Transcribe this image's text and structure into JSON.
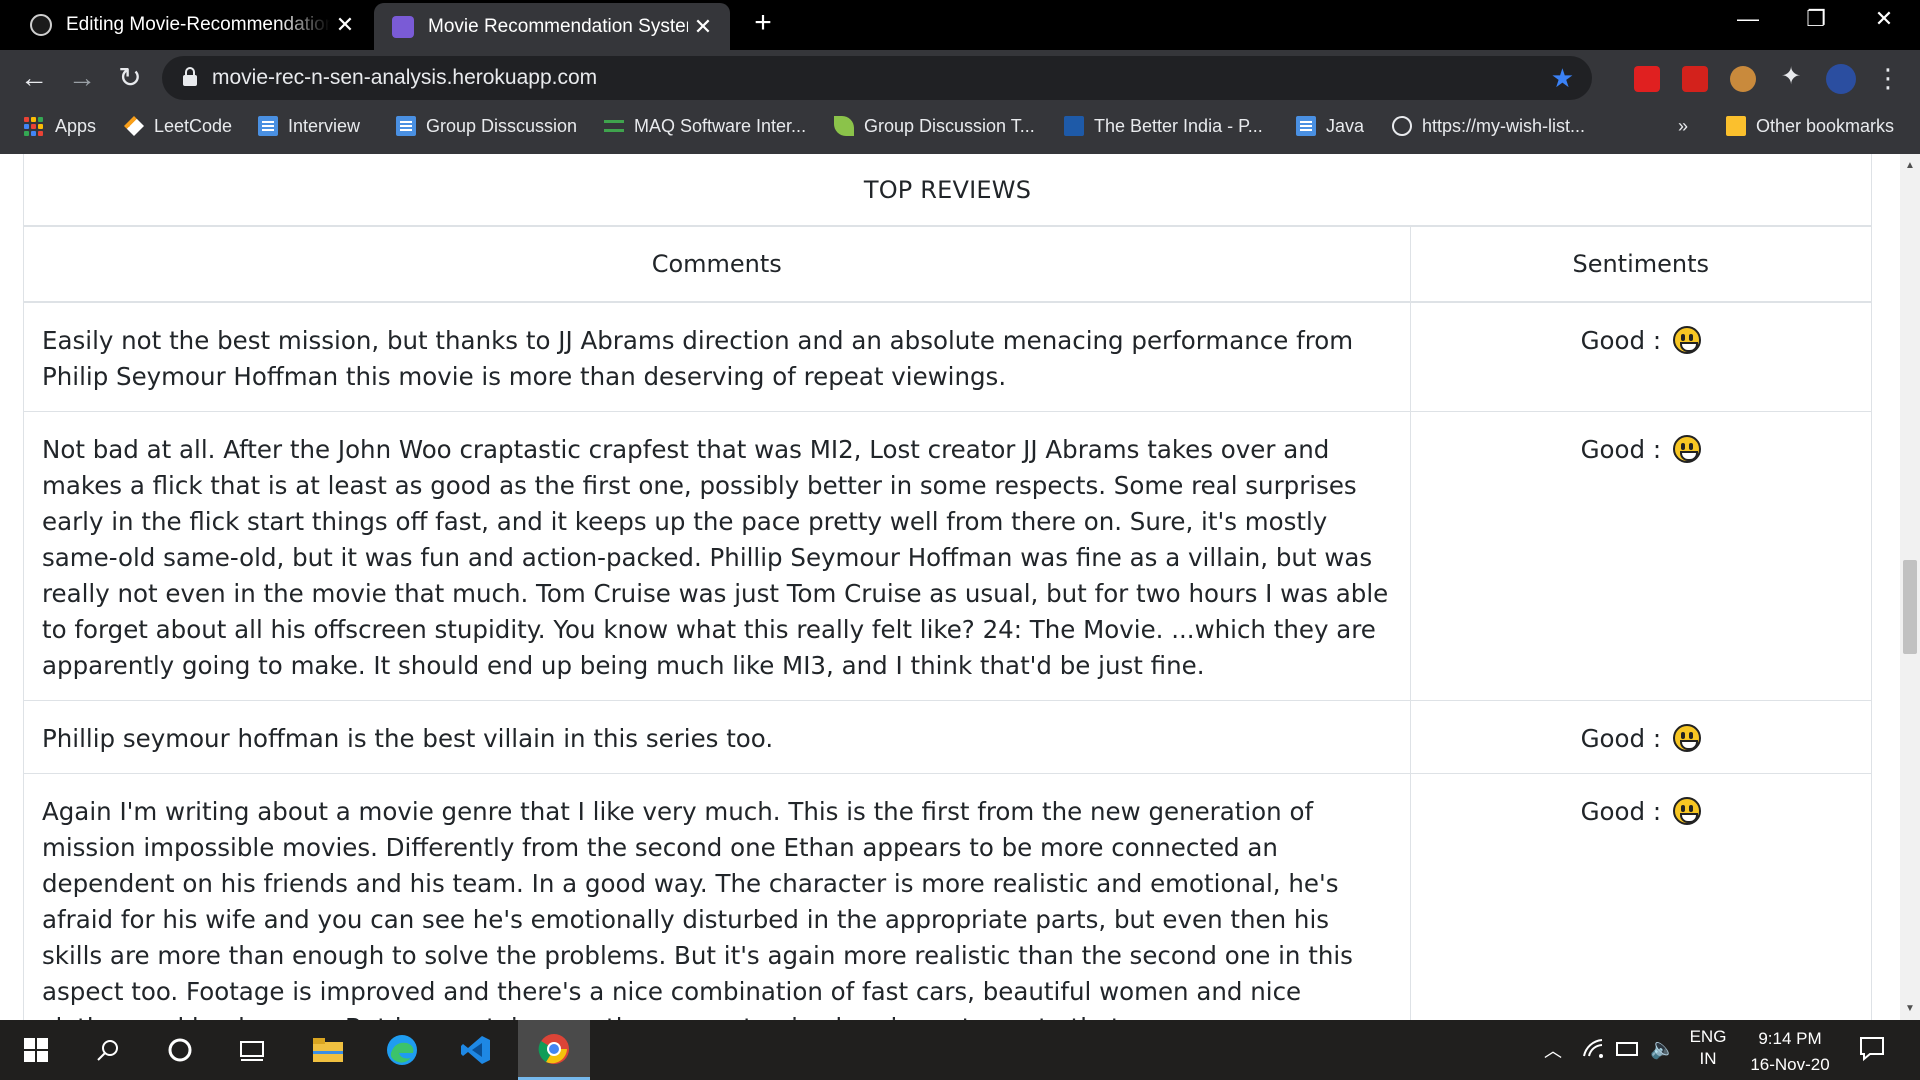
{
  "browser": {
    "tabs": [
      {
        "title": "Editing Movie-Recommendation",
        "close": "✕"
      },
      {
        "title": "Movie Recommendation System",
        "close": "✕"
      }
    ],
    "new_tab": "+",
    "window": {
      "minimize": "—",
      "restore": "❐",
      "close": "✕"
    },
    "nav": {
      "back": "←",
      "forward": "→",
      "reload": "↻"
    },
    "url": "movie-rec-n-sen-analysis.herokuapp.com",
    "bookmark_star": "★",
    "menu": "⋮",
    "extensions_icon": "✦",
    "bookmarks": [
      {
        "label": "Apps",
        "icon": "apps-grid-icon"
      },
      {
        "label": "LeetCode",
        "icon": "leetcode-icon"
      },
      {
        "label": "Interview",
        "icon": "docs-icon"
      },
      {
        "label": "Group Disscussion",
        "icon": "docs-icon"
      },
      {
        "label": "MAQ Software Inter...",
        "icon": "maq-icon"
      },
      {
        "label": "Group Discussion T...",
        "icon": "leaf-icon"
      },
      {
        "label": "The Better India - P...",
        "icon": "better-india-icon"
      },
      {
        "label": "Java",
        "icon": "docs-icon"
      },
      {
        "label": "https://my-wish-list...",
        "icon": "globe-icon"
      }
    ],
    "bookmarks_overflow": "»",
    "other_bookmarks": "Other bookmarks"
  },
  "page": {
    "section_title": "TOP REVIEWS",
    "columns": {
      "comments": "Comments",
      "sentiments": "Sentiments"
    },
    "reviews": [
      {
        "comment": "Easily not the best mission, but thanks to JJ Abrams direction and an absolute menacing performance from Philip Seymour Hoffman this movie is more than deserving of repeat viewings.",
        "sentiment": "Good :"
      },
      {
        "comment": "Not bad at all. After the John Woo craptastic crapfest that was MI2, Lost creator JJ Abrams takes over and makes a flick that is at least as good as the first one, possibly better in some respects. Some real surprises early in the flick start things off fast, and it keeps up the pace pretty well from there on. Sure, it's mostly same-old same-old, but it was fun and action-packed. Phillip Seymour Hoffman was fine as a villain, but was really not even in the movie that much. Tom Cruise was just Tom Cruise as usual, but for two hours I was able to forget about all his offscreen stupidity. You know what this really felt like? 24: The Movie. ...which they are apparently going to make. It should end up being much like MI3, and I think that'd be just fine.",
        "sentiment": "Good :"
      },
      {
        "comment": "Phillip seymour hoffman is the best villain in this series too.",
        "sentiment": "Good :"
      },
      {
        "comment": "Again I'm writing about a movie genre that I like very much. This is the first from the new generation of mission impossible movies. Differently from the second one Ethan appears to be more connected an dependent on his friends and his team. In a good way. The character is more realistic and emotional, he's afraid for his wife and you can see he's emotionally disturbed in the appropriate parts, but even then his skills are more than enough to solve the problems. But it's again more realistic than the second one in this aspect too. Footage is improved and there's a nice combination of fast cars, beautiful women and nice clothes and landscapes. But in a certain way, they seem to give less importance to that",
        "sentiment": "Good :"
      }
    ]
  },
  "taskbar": {
    "language": "ENG",
    "region": "IN",
    "time": "9:14 PM",
    "date": "16-Nov-20"
  },
  "colors": {
    "titlebar": "#000000",
    "toolbar": "#35363a",
    "omnibox": "#202124",
    "star": "#3b82f6",
    "table_border": "#dee2e6",
    "text": "#212529",
    "taskbar": "#201f1e",
    "emoji": "#f7c623"
  }
}
